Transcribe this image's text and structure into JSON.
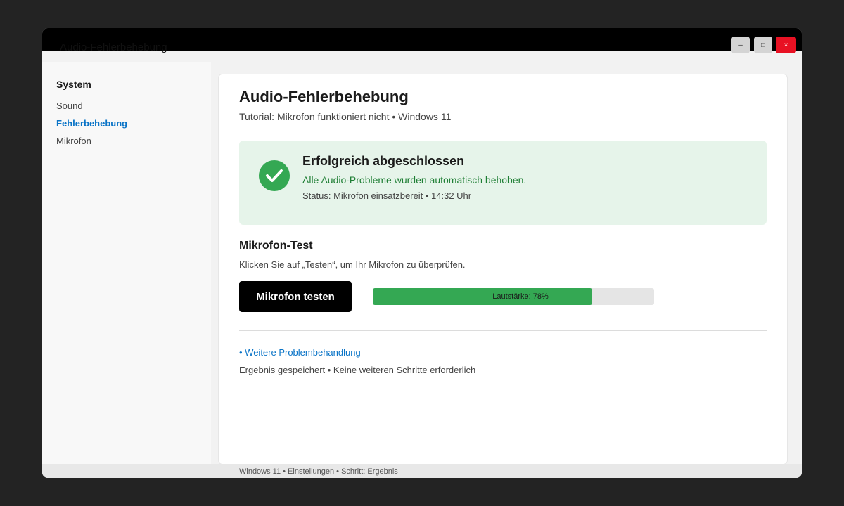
{
  "window": {
    "title": "Audio-Fehlerbehebung",
    "minimize": "–",
    "maximize": "□",
    "close": "×"
  },
  "sidebar": {
    "heading": "System",
    "items": [
      {
        "label": "Sound",
        "active": false
      },
      {
        "label": "Fehlerbehebung",
        "active": true
      },
      {
        "label": "Mikrofon",
        "active": false
      }
    ]
  },
  "main": {
    "title": "Audio-Fehlerbehebung",
    "subtitle": "Tutorial: Mikrofon funktioniert nicht • Windows 11",
    "success": {
      "title": "Erfolgreich abgeschlossen",
      "message": "Alle Audio-Probleme wurden automatisch behoben.",
      "status": "Status: Mikrofon einsatzbereit • 14:32 Uhr",
      "icon": "checkmark-icon"
    },
    "mic_test": {
      "title": "Mikrofon-Test",
      "description": "Klicken Sie auf „Testen“, um Ihr Mikrofon zu überprüfen.",
      "button_label": "Mikrofon testen",
      "volume_label": "Lautstärke: 78%",
      "volume_level": 0.78
    },
    "link_label": "• Weitere Problembehandlung",
    "result_text": "Ergebnis gespeichert • Keine weiteren Schritte erforderlich"
  },
  "statusbar": {
    "text": "Windows 11 • Einstellungen • Schritt: Ergebnis"
  },
  "colors": {
    "accent": "#0a74c7",
    "success": "#34a853",
    "success_bg": "#e6f4ea",
    "close_button": "#e81123"
  }
}
